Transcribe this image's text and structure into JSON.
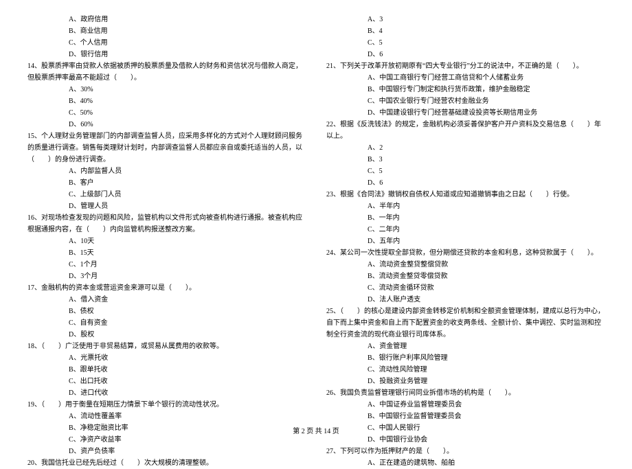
{
  "left": {
    "q13opts": [
      "A、政府信用",
      "B、商业信用",
      "C、个人信用",
      "D、银行信用"
    ],
    "q14": "14、股票质押率由贷款人依据被质押的股票质量及借款人的财务和资信状况与借款人商定，但股票质押率最高不能超过（　　）。",
    "q14opts": [
      "A、30%",
      "B、40%",
      "C、50%",
      "D、60%"
    ],
    "q15": "15、个人理财业务管理部门的内部调查监督人员，应采用多样化的方式对个人理财顾问服务的质量进行调查。销售每类理财计划时，内部调查监督人员都应亲自或委托适当的人员，以（　　）的身份进行调查。",
    "q15opts": [
      "A、内部监督人员",
      "B、客户",
      "C、上级部门人员",
      "D、管理人员"
    ],
    "q16": "16、对现场检查发现的问题和风险，监管机构以文件形式向被查机构进行通报。被查机构应根据通报内容，在（　　）内向监管机构报送整改方案。",
    "q16opts": [
      "A、10天",
      "B、15天",
      "C、1个月",
      "D、3个月"
    ],
    "q17": "17、金融机构的资本金或营运资金来源可以是（　　）。",
    "q17opts": [
      "A、借入资金",
      "B、债权",
      "C、自有资金",
      "D、股权"
    ],
    "q18": "18、（　　）广泛使用于非贸易结算，或贸易从属费用的收款等。",
    "q18opts": [
      "A、光票托收",
      "B、跟单托收",
      "C、出口托收",
      "D、进口代收"
    ],
    "q19": "19、（　　）用于衡量在短期压力情景下单个银行的流动性状况。",
    "q19opts": [
      "A、流动性覆盖率",
      "B、净稳定融资比率",
      "C、净资产收益率",
      "D、资产负债率"
    ],
    "q20": "20、我国信托业已经先后经过（　　）次大规模的清理整顿。"
  },
  "right": {
    "q20opts": [
      "A、3",
      "B、4",
      "C、5",
      "D、6"
    ],
    "q21": "21、下列关于改革开放初期原有“四大专业银行”分工的说法中，不正确的是（　　）。",
    "q21opts": [
      "A、中国工商银行专门经营工商信贷和个人储蓄业务",
      "B、中国银行专门制定和执行货币政策，维护金融稳定",
      "C、中国农业银行专门经营农村金融业务",
      "D、中国建设银行专门经营基础建设投资等长期信用业务"
    ],
    "q22": "22、根据《反洗钱法》的规定，金融机构必须妥善保护客户开户资料及交易信息（　　）年以上。",
    "q22opts": [
      "A、2",
      "B、3",
      "C、5",
      "D、6"
    ],
    "q23": "23、根据《合同法》撤销权自债权人知道或应知道撤销事由之日起（　　）行使。",
    "q23opts": [
      "A、半年内",
      "B、一年内",
      "C、二年内",
      "D、五年内"
    ],
    "q24": "24、某公司一次性提取全部贷款，但分期偿还贷款的本金和利息，这种贷款属于（　　）。",
    "q24opts": [
      "A、流动资金整贷整偿贷款",
      "B、流动资金整贷零偿贷款",
      "C、流动资金循环贷款",
      "D、法人账户透支"
    ],
    "q25": "25、（　　）的核心是建设内部资金转移定价机制和全额资金管理体制，建成以总行为中心，自下而上集中资金和自上而下配置资金的收支两条线、全额计价、集中调控、实时监测和控制全行资金流的现代商业银行司库体系。",
    "q25opts": [
      "A、资金管理",
      "B、银行账户利率风险管理",
      "C、流动性风险管理",
      "D、投融资业务管理"
    ],
    "q26": "26、我国负责监督管理银行间同业拆借市场的机构是（　　）。",
    "q26opts": [
      "A、中国证券业监督管理委员会",
      "B、中国银行业监督管理委员会",
      "C、中国人民银行",
      "D、中国银行业协会"
    ],
    "q27": "27、下列可以作为抵押财产的是（　　）。",
    "q27opts_partial": [
      "A、正在建造的建筑物、船舶"
    ]
  },
  "footer": "第 2 页 共 14 页"
}
